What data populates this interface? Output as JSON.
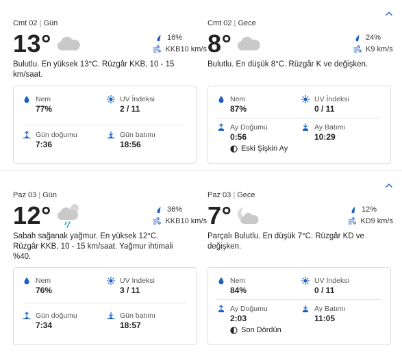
{
  "days": [
    {
      "day": {
        "date": "Cmt 02",
        "period": "Gün",
        "temp": "13°",
        "icon": "cloud-icon",
        "precip": "16%",
        "wind": "KKB10 km/s",
        "desc": "Bulutlu. En yüksek 13°C. Rüzgâr KKB, 10 - 15 km/saat.",
        "humidity_label": "Nem",
        "humidity": "77%",
        "uv_label": "UV İndeksi",
        "uv": "2 / 11",
        "rise_label": "Gün doğumu",
        "rise": "7:36",
        "set_label": "Gün batımı",
        "set": "18:56"
      },
      "night": {
        "date": "Cmt 02",
        "period": "Gece",
        "temp": "8°",
        "icon": "cloud-icon",
        "precip": "24%",
        "wind": "K9 km/s",
        "desc": "Bulutlu. En düşük 8°C. Rüzgâr K ve değişken.",
        "humidity_label": "Nem",
        "humidity": "87%",
        "uv_label": "UV İndeksi",
        "uv": "0 / 11",
        "rise_label": "Ay Doğumu",
        "rise": "0:56",
        "set_label": "Ay Batımı",
        "set": "10:29",
        "moon_phase": "Eski Şişkin Ay"
      }
    },
    {
      "day": {
        "date": "Paz 03",
        "period": "Gün",
        "temp": "12°",
        "icon": "rain-shower-icon",
        "precip": "36%",
        "wind": "KKB10 km/s",
        "desc": "Sabah sağanak yağmur. En yüksek 12°C. Rüzgâr KKB, 10 - 15 km/saat. Yağmur ihtimali %40.",
        "humidity_label": "Nem",
        "humidity": "76%",
        "uv_label": "UV İndeksi",
        "uv": "3 / 11",
        "rise_label": "Gün doğumu",
        "rise": "7:34",
        "set_label": "Gün batımı",
        "set": "18:57"
      },
      "night": {
        "date": "Paz 03",
        "period": "Gece",
        "temp": "7°",
        "icon": "partly-cloudy-night-icon",
        "precip": "12%",
        "wind": "KD9 km/s",
        "desc": "Parçalı Bulutlu. En düşük 7°C. Rüzgâr KD ve değişken.",
        "humidity_label": "Nem",
        "humidity": "84%",
        "uv_label": "UV İndeksi",
        "uv": "0 / 11",
        "rise_label": "Ay Doğumu",
        "rise": "2:03",
        "set_label": "Ay Batımı",
        "set": "11:05",
        "moon_phase": "Son Dördün"
      }
    }
  ],
  "colors": {
    "accent": "#1b5fc1",
    "text": "#262626",
    "muted": "#8a8a8a",
    "border": "#dcdcdc",
    "cloud": "#c9c9c9"
  }
}
